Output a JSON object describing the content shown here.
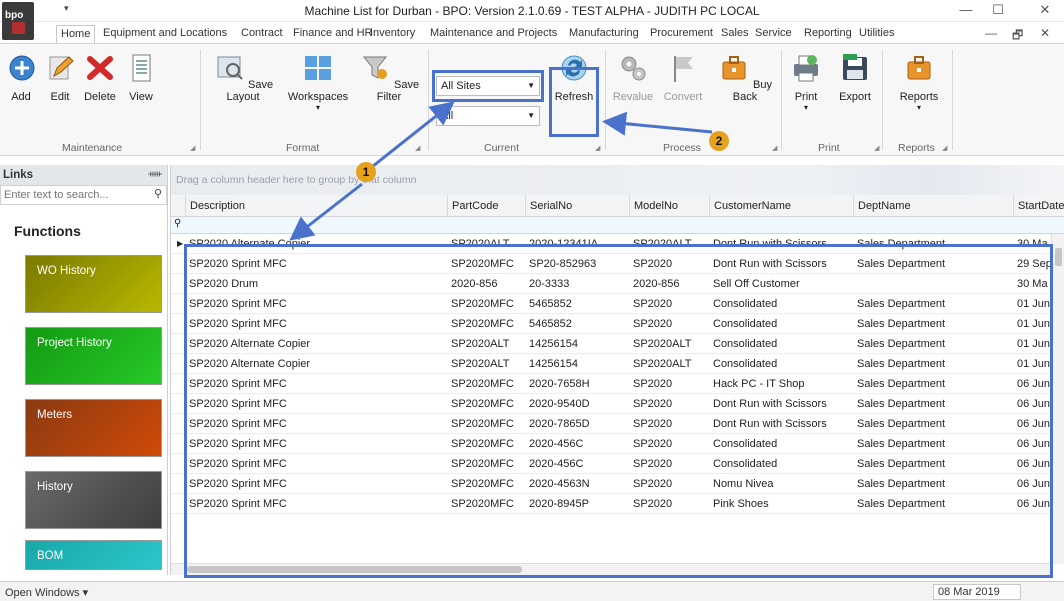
{
  "window": {
    "logo": "bpo",
    "title": "Machine List for Durban - BPO: Version 2.1.0.69 - TEST ALPHA - JUDITH PC LOCAL",
    "minimize": "—",
    "maximize": "☐",
    "close": "✕"
  },
  "tabs": [
    "Home",
    "Equipment and Locations",
    "Contract",
    "Finance and HR",
    "Inventory",
    "Maintenance and Projects",
    "Manufacturing",
    "Procurement",
    "Sales",
    "Service",
    "Reporting",
    "Utilities"
  ],
  "ribbon_controls": {
    "minimize": "—",
    "restore": "🗗",
    "close": "✕"
  },
  "ribbon": {
    "maintenance": {
      "label": "Maintenance",
      "add": "Add",
      "edit": "Edit",
      "delete": "Delete",
      "view": "View"
    },
    "format": {
      "label": "Format",
      "save_layout": "Save Layout",
      "workspaces": "Workspaces",
      "save_filter": "Save Filter"
    },
    "current": {
      "label": "Current",
      "site_value": "All Sites",
      "second_value": "All",
      "refresh": "Refresh"
    },
    "process": {
      "label": "Process",
      "revalue": "Revalue",
      "convert": "Convert",
      "buy_back": "Buy Back"
    },
    "print": {
      "label": "Print",
      "print": "Print",
      "export": "Export"
    },
    "reports": {
      "label": "Reports",
      "reports": "Reports"
    }
  },
  "links": {
    "header": "Links",
    "search_placeholder": "Enter text to search...",
    "title": "Functions",
    "buttons": [
      {
        "label": "WO History",
        "color": "#b8b800"
      },
      {
        "label": "Project History",
        "color": "#22bb22"
      },
      {
        "label": "Meters",
        "color": "#c14a10"
      },
      {
        "label": "History",
        "color": "#5a5a5a"
      },
      {
        "label": "BOM",
        "color": "#1fb5b8"
      }
    ]
  },
  "grid": {
    "group_hint": "Drag a column header here to group by that column",
    "columns": [
      "Description",
      "PartCode",
      "SerialNo",
      "ModelNo",
      "CustomerName",
      "DeptName",
      "StartDate"
    ],
    "rows": [
      [
        "SP2020 Alternate Copier",
        "SP2020ALT",
        "2020-12341IA",
        "SP2020ALT",
        "Dont Run with Scissors",
        "Sales Department",
        "30 Ma"
      ],
      [
        "SP2020 Sprint MFC",
        "SP2020MFC",
        "SP20-852963",
        "SP2020",
        "Dont Run with Scissors",
        "Sales Department",
        "29 Sep"
      ],
      [
        "SP2020 Drum",
        "2020-856",
        "20-3333",
        "2020-856",
        "Sell Off Customer",
        "",
        "30 Ma"
      ],
      [
        "SP2020 Sprint MFC",
        "SP2020MFC",
        "5465852",
        "SP2020",
        "Consolidated",
        "Sales Department",
        "01 Jun"
      ],
      [
        "SP2020 Sprint MFC",
        "SP2020MFC",
        "5465852",
        "SP2020",
        "Consolidated",
        "Sales Department",
        "01 Jun"
      ],
      [
        "SP2020 Alternate Copier",
        "SP2020ALT",
        "14256154",
        "SP2020ALT",
        "Consolidated",
        "Sales Department",
        "01 Jun"
      ],
      [
        "SP2020 Alternate Copier",
        "SP2020ALT",
        "14256154",
        "SP2020ALT",
        "Consolidated",
        "Sales Department",
        "01 Jun"
      ],
      [
        "SP2020 Sprint MFC",
        "SP2020MFC",
        "2020-7658H",
        "SP2020",
        "Hack PC - IT Shop",
        "Sales Department",
        "06 Jun"
      ],
      [
        "SP2020 Sprint MFC",
        "SP2020MFC",
        "2020-9540D",
        "SP2020",
        "Dont Run with Scissors",
        "Sales Department",
        "06 Jun"
      ],
      [
        "SP2020 Sprint MFC",
        "SP2020MFC",
        "2020-7865D",
        "SP2020",
        "Dont Run with Scissors",
        "Sales Department",
        "06 Jun"
      ],
      [
        "SP2020 Sprint MFC",
        "SP2020MFC",
        "2020-456C",
        "SP2020",
        "Consolidated",
        "Sales Department",
        "06 Jun"
      ],
      [
        "SP2020 Sprint MFC",
        "SP2020MFC",
        "2020-456C",
        "SP2020",
        "Consolidated",
        "Sales Department",
        "06 Jun"
      ],
      [
        "SP2020 Sprint MFC",
        "SP2020MFC",
        "2020-4563N",
        "SP2020",
        "Nomu Nivea",
        "Sales Department",
        "06 Jun"
      ],
      [
        "SP2020 Sprint MFC",
        "SP2020MFC",
        "2020-8945P",
        "SP2020",
        "Pink Shoes",
        "Sales Department",
        "06 Jun"
      ]
    ]
  },
  "status": {
    "open_windows": "Open Windows ▾",
    "date": "08 Mar 2019"
  },
  "annotations": {
    "one": "1",
    "two": "2",
    "color": "#4a72cc",
    "badge_color": "#e6a21c"
  }
}
